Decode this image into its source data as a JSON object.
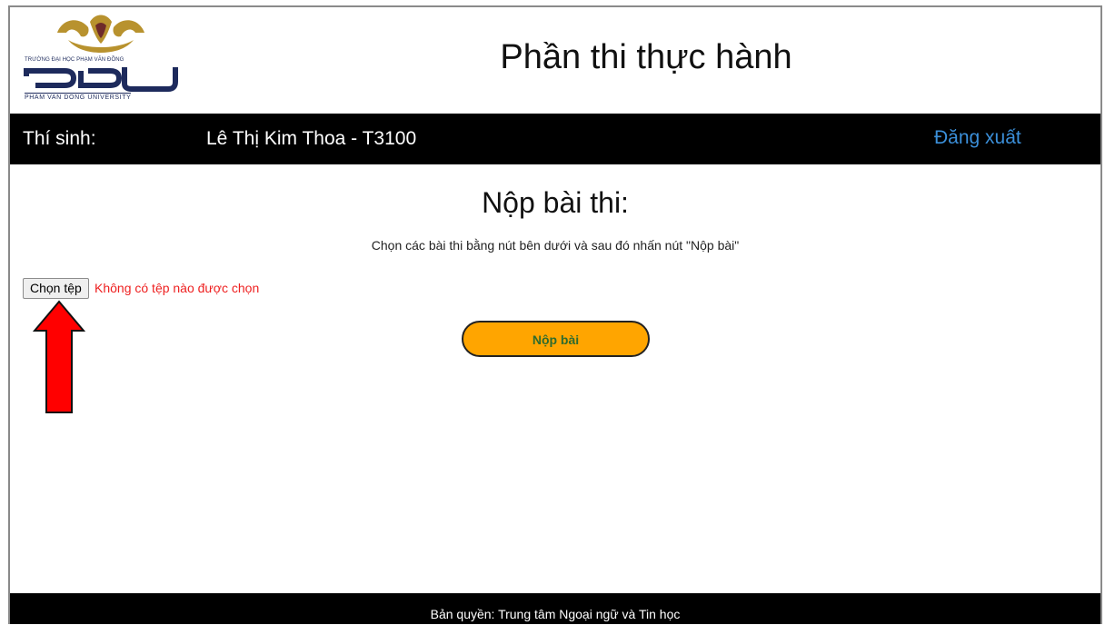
{
  "header": {
    "logo": {
      "top_text": "TRƯỜNG ĐẠI HỌC PHẠM VĂN ĐỒNG",
      "mark_text": "PDU",
      "bottom_text": "PHAM VAN DONG UNIVERSITY",
      "gold": "#b8922e",
      "navy": "#1d2a5c"
    },
    "title": "Phần thi thực hành"
  },
  "navbar": {
    "candidate_label": "Thí sinh:",
    "candidate_name": "Lê Thị Kim Thoa - T3100",
    "logout_label": "Đăng xuất"
  },
  "main": {
    "section_title": "Nộp bài thi:",
    "instructions": "Chọn các bài thi bằng nút bên dưới và sau đó nhấn nút \"Nộp bài\"",
    "file_button_label": "Chọn tệp",
    "file_status": "Không có tệp nào được chọn",
    "submit_label": "Nộp bài"
  },
  "annotation": {
    "arrow_icon": "up-arrow-icon",
    "arrow_color": "#ff0000"
  },
  "footer": {
    "copyright": "Bản quyền: Trung tâm Ngoại ngữ và Tin học"
  },
  "colors": {
    "accent_button": "#ffa500",
    "link": "#3b8fd9",
    "error_text": "#ee2020",
    "bar_background": "#000000"
  }
}
